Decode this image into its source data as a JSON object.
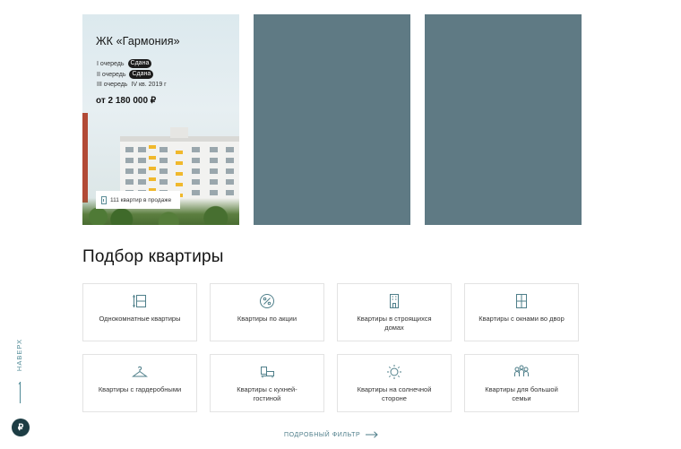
{
  "projects": {
    "main": {
      "title": "ЖК «Гармония»",
      "phases": [
        {
          "name": "I очередь",
          "status": "Сдана"
        },
        {
          "name": "II очередь",
          "status": "Сдана"
        },
        {
          "name": "III очередь",
          "status": "IV кв. 2019 г"
        }
      ],
      "price": "от 2 180 000 ₽",
      "sales_badge": "111 квартир в продаже"
    }
  },
  "section": {
    "title": "Подбор квартиры"
  },
  "filters": [
    {
      "label": "Однокомнатные квартиры",
      "icon": "ruler-room-icon"
    },
    {
      "label": "Квартиры по акции",
      "icon": "percent-icon"
    },
    {
      "label": "Квартиры в строящихся домах",
      "icon": "building-icon"
    },
    {
      "label": "Квартиры с окнами во двор",
      "icon": "window-icon"
    },
    {
      "label": "Квартиры с гардеробными",
      "icon": "hanger-icon"
    },
    {
      "label": "Квартиры с кухней-гостиной",
      "icon": "kitchen-icon"
    },
    {
      "label": "Квартиры на солнечной стороне",
      "icon": "sun-icon"
    },
    {
      "label": "Квартиры для большой семьи",
      "icon": "family-icon"
    }
  ],
  "filter_link": "ПОДРОБНЫЙ ФИЛЬТР",
  "side": {
    "to_top": "НАВЕРХ",
    "ruble_symbol": "₽"
  },
  "colors": {
    "accent": "#4f8a96",
    "card_placeholder": "#5f7a84",
    "badge_dark": "#1b1b1b"
  }
}
